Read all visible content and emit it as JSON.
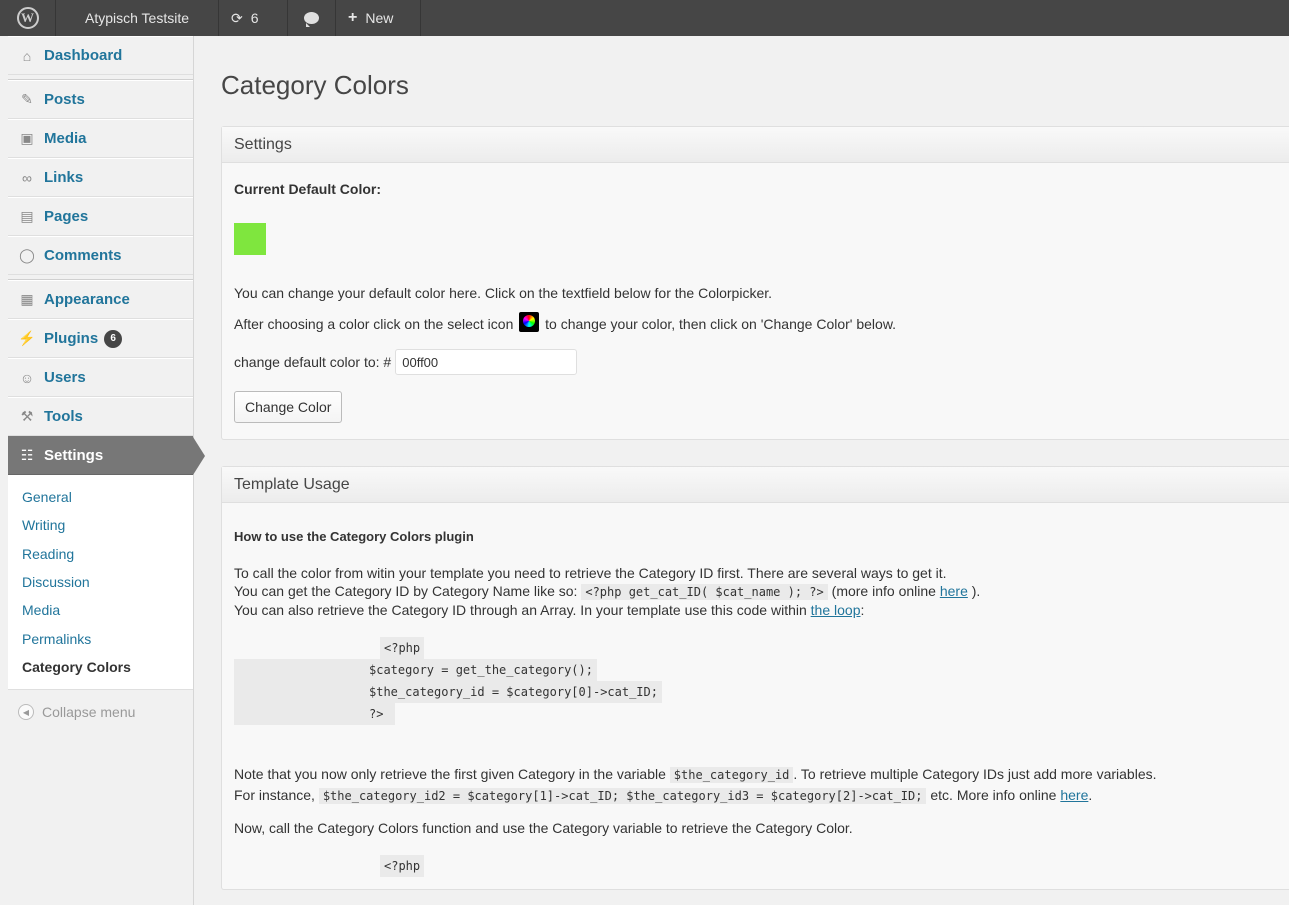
{
  "adminbar": {
    "site_name": "Atypisch Testsite",
    "updates_count": "6",
    "new_label": "New"
  },
  "sidebar": {
    "items": [
      {
        "label": "Dashboard",
        "icon": "home-icon"
      },
      {
        "label": "Posts",
        "icon": "pin-icon"
      },
      {
        "label": "Media",
        "icon": "media-icon"
      },
      {
        "label": "Links",
        "icon": "link-icon"
      },
      {
        "label": "Pages",
        "icon": "pages-icon"
      },
      {
        "label": "Comments",
        "icon": "comment-icon"
      },
      {
        "label": "Appearance",
        "icon": "appearance-icon"
      },
      {
        "label": "Plugins",
        "icon": "plug-icon",
        "badge": "6"
      },
      {
        "label": "Users",
        "icon": "users-icon"
      },
      {
        "label": "Tools",
        "icon": "tools-icon"
      },
      {
        "label": "Settings",
        "icon": "settings-icon"
      }
    ],
    "submenu": [
      "General",
      "Writing",
      "Reading",
      "Discussion",
      "Media",
      "Permalinks",
      "Category Colors"
    ],
    "collapse_label": "Collapse menu"
  },
  "page": {
    "title": "Category Colors",
    "settings_box": {
      "title": "Settings",
      "current_label": "Current Default Color:",
      "current_color": "#7fe63e",
      "line1": "You can change your default color here. Click on the textfield below for the Colorpicker.",
      "line2_before": "After choosing a color click on the select icon",
      "line2_after": "to change your color, then click on 'Change Color' below.",
      "field_label": "change default color to: #",
      "field_value": "00ff00",
      "button_label": "Change Color"
    },
    "template_box": {
      "title": "Template Usage",
      "heading": "How to use the Category Colors plugin",
      "p1": "To call the color from witin your template you need to retrieve the Category ID first. There are several ways to get it.",
      "p2_before": "You can get the Category ID by Category Name like so:",
      "p2_code": "<?php get_cat_ID( $cat_name ); ?>",
      "p2_mid": "(more info online",
      "p2_link": "here",
      "p2_after": ").",
      "p3_before": "You can also retrieve the Category ID through an Array. In your template use this code within",
      "p3_link": "the loop",
      "p3_after": ":",
      "code1": [
        "<?php",
        "$category = get_the_category();",
        "$the_category_id = $category[0]->cat_ID;",
        "?>"
      ],
      "p4_before": "Note that you now only retrieve the first given Category in the variable",
      "p4_code": "$the_category_id",
      "p4_after": ". To retrieve multiple Category IDs just add more variables.",
      "p5_before": "For instance,",
      "p5_code": "$the_category_id2 = $category[1]->cat_ID; $the_category_id3 = $category[2]->cat_ID;",
      "p5_mid": "etc. More info online",
      "p5_link": "here",
      "p5_after": ".",
      "p6": "Now, call the Category Colors function and use the Category variable to retrieve the Category Color.",
      "code2_first": "<?php"
    }
  }
}
